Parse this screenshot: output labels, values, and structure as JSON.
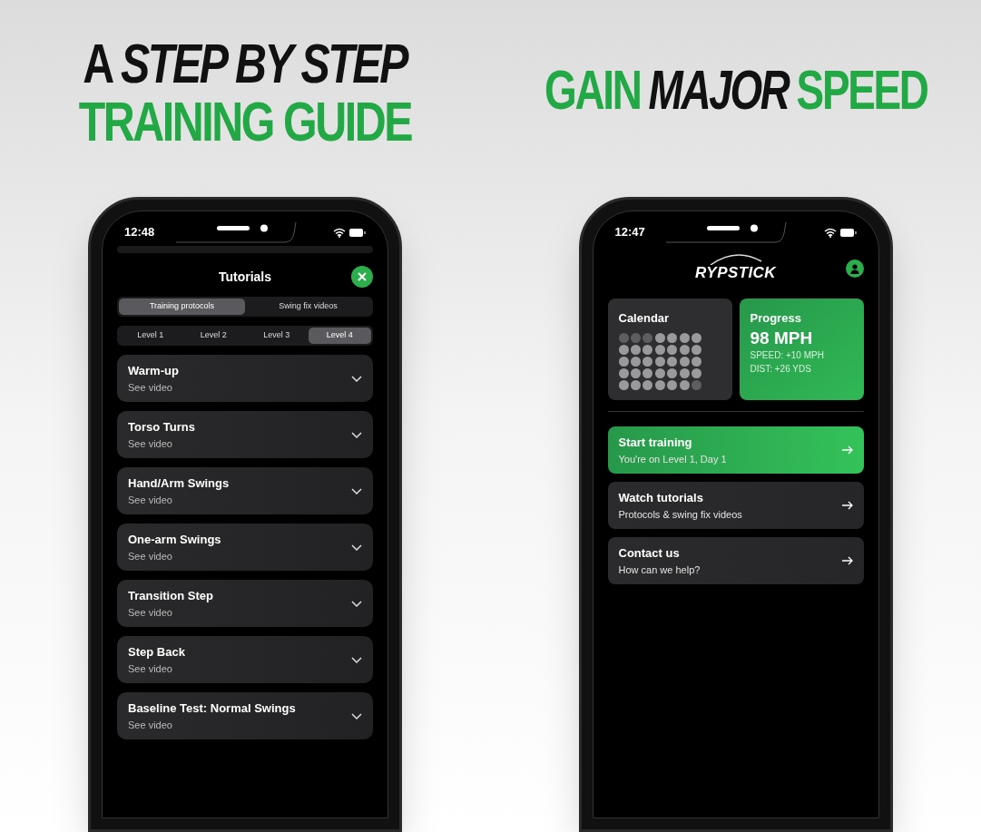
{
  "left_panel": {
    "headline": [
      {
        "text": "A *STEP BY STEP*",
        "color": "#111111"
      },
      {
        "text": "TRAINING GUIDE",
        "color": "#22a845"
      }
    ],
    "phone": {
      "time": "12:48",
      "title": "Tutorials",
      "tabs": [
        {
          "label": "Training protocols",
          "selected": true
        },
        {
          "label": "Swing fix videos",
          "selected": false
        }
      ],
      "levels": [
        {
          "label": "Level 1",
          "selected": false
        },
        {
          "label": "Level 2",
          "selected": false
        },
        {
          "label": "Level 3",
          "selected": false
        },
        {
          "label": "Level 4",
          "selected": true
        }
      ],
      "items": [
        {
          "title": "Warm-up",
          "subtitle": "See video",
          "expanded": false
        },
        {
          "title": "Torso Turns",
          "subtitle": "See video",
          "expanded": false
        },
        {
          "title": "Hand/Arm Swings",
          "subtitle": "See video",
          "expanded": false
        },
        {
          "title": "One-arm Swings",
          "subtitle": "See video",
          "expanded": false
        },
        {
          "title": "Transition Step",
          "subtitle": "See video",
          "expanded": false
        },
        {
          "title": "Step Back",
          "subtitle": "See video",
          "expanded": false
        },
        {
          "title": "Baseline Test: Normal Swings",
          "subtitle": "See video",
          "expanded": false
        }
      ]
    }
  },
  "right_panel": {
    "headline": [
      {
        "text": "GAIN",
        "italic": false,
        "color": "#22a845"
      },
      {
        "text": "MAJOR",
        "italic": true,
        "color": "#111111"
      },
      {
        "text": "SPEED",
        "italic": false,
        "color": "#22a845"
      }
    ],
    "phone": {
      "time": "12:47",
      "logo": "RYPSTICK",
      "calendar": {
        "title": "Calendar",
        "days": [
          {
            "dimmed": true
          },
          {
            "dimmed": true
          },
          {
            "dimmed": true
          },
          {
            "dimmed": false
          },
          {
            "dimmed": false
          },
          {
            "dimmed": false
          },
          {
            "dimmed": false
          },
          {
            "dimmed": false
          },
          {
            "dimmed": false
          },
          {
            "dimmed": false
          },
          {
            "dimmed": false
          },
          {
            "dimmed": false
          },
          {
            "dimmed": false
          },
          {
            "dimmed": false
          },
          {
            "dimmed": false
          },
          {
            "dimmed": false
          },
          {
            "dimmed": false
          },
          {
            "dimmed": false
          },
          {
            "dimmed": false
          },
          {
            "dimmed": false
          },
          {
            "dimmed": false
          },
          {
            "dimmed": false
          },
          {
            "dimmed": false
          },
          {
            "dimmed": false
          },
          {
            "dimmed": false
          },
          {
            "dimmed": false
          },
          {
            "dimmed": false
          },
          {
            "dimmed": false
          },
          {
            "dimmed": false
          },
          {
            "dimmed": false
          },
          {
            "dimmed": false
          },
          {
            "dimmed": false
          },
          {
            "dimmed": false
          },
          {
            "dimmed": false
          },
          {
            "dimmed": true
          }
        ]
      },
      "progress": {
        "title": "Progress",
        "value": "98 MPH",
        "lines": [
          "SPEED: +10 MPH",
          "DIST: +26 YDS"
        ]
      },
      "menu": [
        {
          "title": "Start training",
          "subtitle": "You're on Level 1, Day 1",
          "highlighted": true
        },
        {
          "title": "Watch tutorials",
          "subtitle": "Protocols & swing fix videos",
          "highlighted": false
        },
        {
          "title": "Contact us",
          "subtitle": "How can we help?",
          "highlighted": false
        }
      ]
    }
  }
}
